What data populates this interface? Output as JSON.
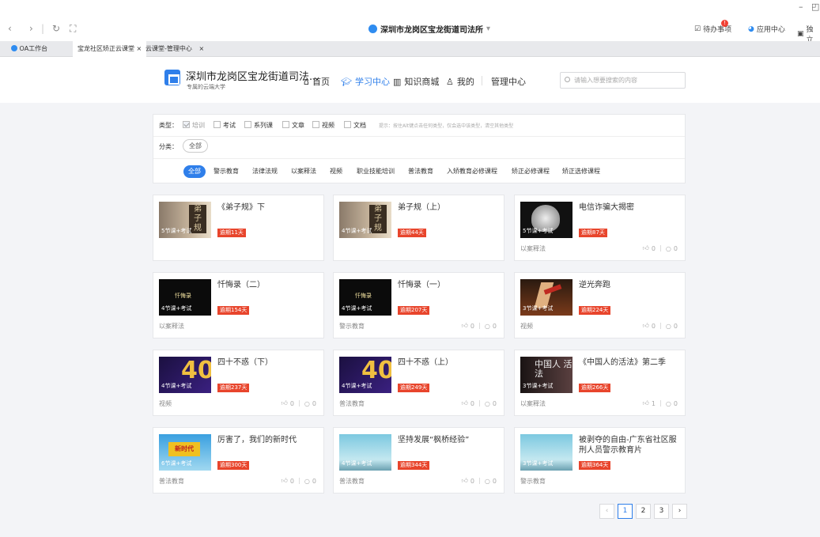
{
  "browser": {
    "title": "深圳市龙岗区宝龙街道司法所",
    "todo": "待办事项",
    "todo_badge": "!",
    "app_center": "应用中心",
    "independent": "独立",
    "tabs": [
      {
        "label": "OA工作台"
      },
      {
        "label": "宝龙社区矫正云课堂"
      },
      {
        "label": "云课堂-管理中心"
      }
    ]
  },
  "site": {
    "name": "深圳市龙岗区宝龙街道司法...",
    "subtitle": "专属的云端大学",
    "nav": [
      {
        "label": "首页"
      },
      {
        "label": "学习中心"
      },
      {
        "label": "知识商城"
      },
      {
        "label": "我的"
      },
      {
        "label": "管理中心"
      }
    ],
    "search_placeholder": "请输入想要搜索的内容"
  },
  "filter": {
    "type_label": "类型：",
    "types": [
      {
        "label": "培训",
        "checked": true
      },
      {
        "label": "考试"
      },
      {
        "label": "系列课"
      },
      {
        "label": "文章"
      },
      {
        "label": "视频"
      },
      {
        "label": "文档"
      }
    ],
    "hint": "提示：按住Alt键点击任何类型，仅会选中该类型，清空其他类型",
    "category_label": "分类：",
    "category_all": "全部",
    "subcategories": [
      "全部",
      "警示教育",
      "法律法规",
      "以案释法",
      "视频",
      "职业技能培训",
      "普法教育",
      "入矫教育必修课程",
      "矫正必修课程",
      "矫正选修课程"
    ]
  },
  "courses": [
    {
      "title": "《弟子规》下",
      "lessons": "5节课+考试",
      "due": "逾期11天",
      "category": "",
      "likes": null,
      "comments": null,
      "thumb": "dizigui"
    },
    {
      "title": "弟子规（上）",
      "lessons": "4节课+考试",
      "due": "逾期44天",
      "category": "",
      "likes": null,
      "comments": null,
      "thumb": "dizigui"
    },
    {
      "title": "电信诈骗大揭密",
      "lessons": "5节课+考试",
      "due": "逾期87天",
      "category": "以案释法",
      "likes": "0",
      "comments": "0",
      "thumb": "fraud"
    },
    {
      "title": "忏悔录（二）",
      "lessons": "4节课+考试",
      "due": "逾期154天",
      "category": "以案释法",
      "likes": null,
      "comments": null,
      "thumb": "dark",
      "thumb_text": "忏悔录"
    },
    {
      "title": "忏悔录（一）",
      "lessons": "4节课+考试",
      "due": "逾期207天",
      "category": "警示教育",
      "likes": "0",
      "comments": "0",
      "thumb": "dark",
      "thumb_text": "忏悔录"
    },
    {
      "title": "逆光奔跑",
      "lessons": "3节课+考试",
      "due": "逾期224天",
      "category": "视频",
      "likes": "0",
      "comments": "0",
      "thumb": "run"
    },
    {
      "title": "四十不惑（下）",
      "lessons": "4节课+考试",
      "due": "逾期237天",
      "category": "视频",
      "likes": "0",
      "comments": "0",
      "thumb": "forty"
    },
    {
      "title": "四十不惑（上）",
      "lessons": "4节课+考试",
      "due": "逾期249天",
      "category": "普法教育",
      "likes": "0",
      "comments": "0",
      "thumb": "forty"
    },
    {
      "title": "《中国人的活法》第二季",
      "lessons": "3节课+考试",
      "due": "逾期266天",
      "category": "以案释法",
      "likes": "1",
      "comments": "0",
      "thumb": "china",
      "thumb_text": "中国人 活法"
    },
    {
      "title": "厉害了，我们的新时代",
      "lessons": "6节课+考试",
      "due": "逾期300天",
      "category": "普法教育",
      "likes": "0",
      "comments": "0",
      "thumb": "era"
    },
    {
      "title": "坚持发展“枫桥经验”",
      "lessons": "4节课+考试",
      "due": "逾期344天",
      "category": "普法教育",
      "likes": "0",
      "comments": "0",
      "thumb": "sky"
    },
    {
      "title": "被剥夺的自由-广东省社区服刑人员警示教育片",
      "lessons": "3节课+考试",
      "due": "逾期364天",
      "category": "警示教育",
      "likes": null,
      "comments": null,
      "thumb": "sky"
    }
  ],
  "pagination": {
    "pages": [
      "1",
      "2",
      "3"
    ],
    "current": "1"
  },
  "colors": {
    "accent": "#2f7fea",
    "due": "#e8452c"
  }
}
